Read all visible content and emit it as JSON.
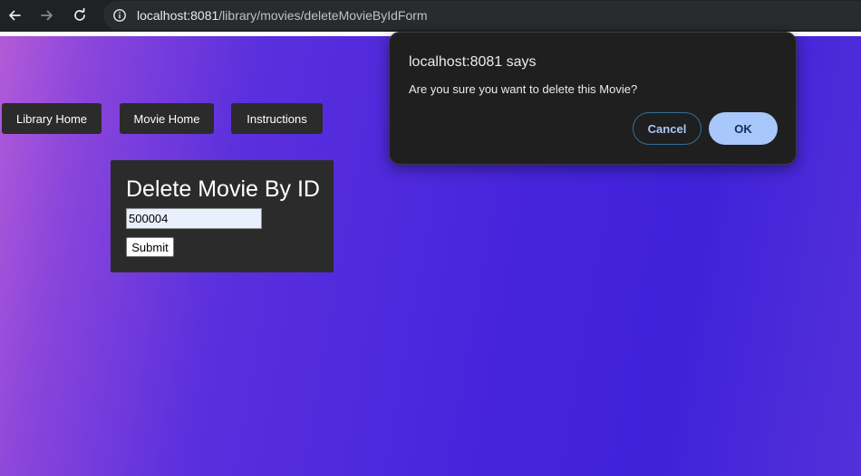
{
  "browser": {
    "url_host": "localhost:8081",
    "url_path": "/library/movies/deleteMovieByIdForm",
    "icons": [
      "back-arrow-icon",
      "forward-arrow-icon",
      "reload-icon",
      "site-info-icon"
    ]
  },
  "nav": {
    "library_home": "Library Home",
    "movie_home": "Movie Home",
    "instructions": "Instructions"
  },
  "form": {
    "title": "Delete Movie By ID",
    "id_value": "500004",
    "submit_label": "Submit"
  },
  "dialog": {
    "title": "localhost:8081 says",
    "message": "Are you sure you want to delete this Movie?",
    "cancel_label": "Cancel",
    "ok_label": "OK"
  },
  "colors": {
    "browser_bar": "#202124",
    "panel": "#2b2b2b",
    "gradient_start": "#b25bd8",
    "gradient_end": "#3f22d9",
    "dialog_bg": "#1f1f1f",
    "ok_button": "#a8c7fa"
  }
}
